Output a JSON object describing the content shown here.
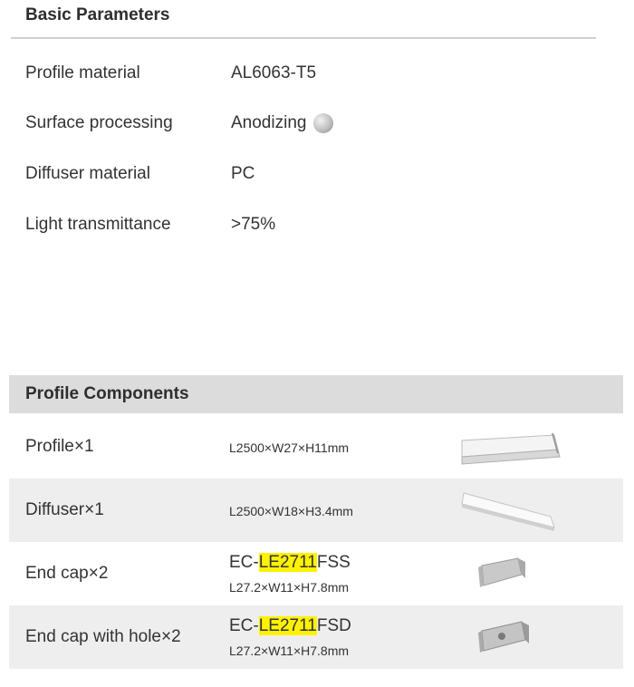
{
  "basic": {
    "title": "Basic Parameters",
    "rows": [
      {
        "label": "Profile material",
        "value": "AL6063-T5"
      },
      {
        "label": "Surface processing",
        "value": "Anodizing"
      },
      {
        "label": "Diffuser material",
        "value": "PC"
      },
      {
        "label": "Light transmittance",
        "value": ">75%"
      }
    ],
    "swatch_color": "#bdbdbd"
  },
  "components": {
    "title": "Profile Components",
    "rows": [
      {
        "label": "Profile×1",
        "dims": "L2500×W27×H11mm",
        "icon": "profile-image"
      },
      {
        "label": "Diffuser×1",
        "dims": "L2500×W18×H3.4mm",
        "icon": "diffuser-image"
      },
      {
        "label": "End cap×2",
        "code_prefix": "EC-",
        "code_highlight": "LE2711",
        "code_suffix": "FSS",
        "dims": "L27.2×W11×H7.8mm",
        "icon": "end-cap-image"
      },
      {
        "label": "End cap with hole×2",
        "code_prefix": "EC-",
        "code_highlight": "LE2711",
        "code_suffix": "FSD",
        "dims": "L27.2×W11×H7.8mm",
        "icon": "end-cap-with-hole-image"
      }
    ],
    "highlight_color": "#fff200",
    "header_color": "#dcdcdc",
    "shade_color": "#eeeeee"
  }
}
